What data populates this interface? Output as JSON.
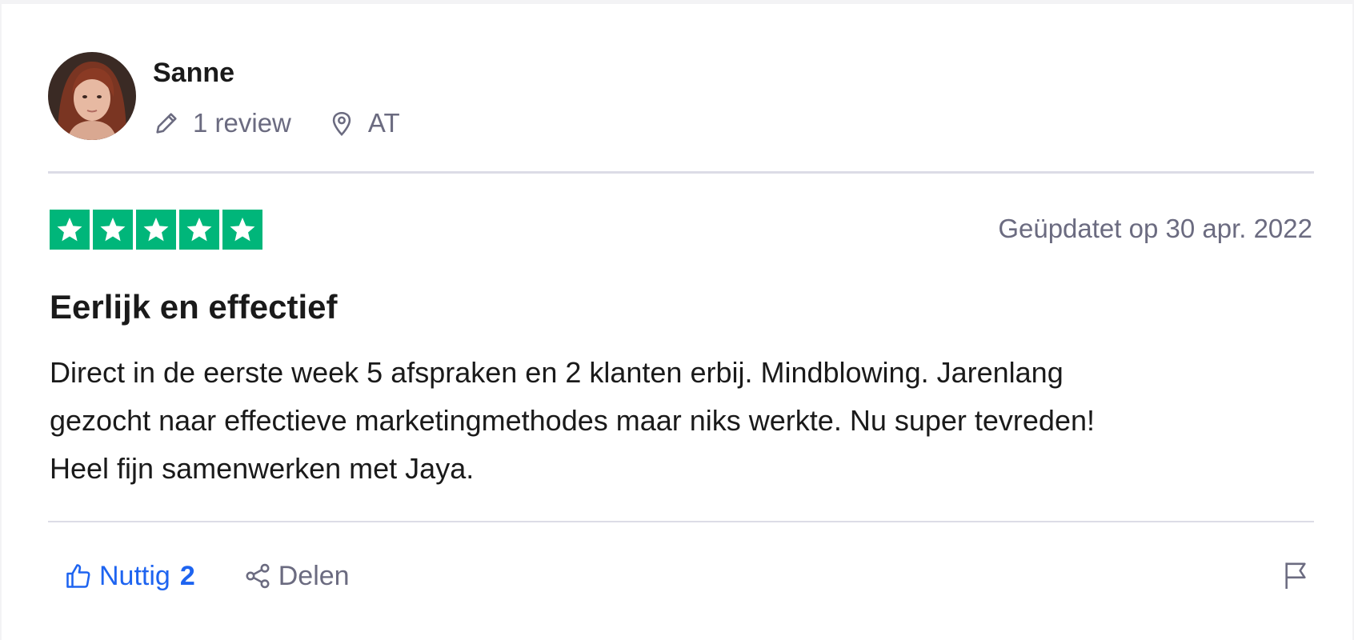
{
  "reviewer": {
    "name": "Sanne",
    "review_count_label": "1 review",
    "country": "AT"
  },
  "review": {
    "rating": 5,
    "rating_max": 5,
    "rating_color": "#00b67a",
    "date_label": "Geüpdatet op 30 apr. 2022",
    "title": "Eerlijk en effectief",
    "body_lines": [
      "Direct in de eerste week 5 afspraken en 2 klanten erbij. Mindblowing. Jarenlang",
      "gezocht naar effectieve marketingmethodes maar niks werkte. Nu super tevreden!",
      "Heel fijn samenwerken met Jaya."
    ]
  },
  "actions": {
    "helpful_label": "Nuttig",
    "helpful_count": "2",
    "share_label": "Delen",
    "helpful_icon": "thumbs-up-icon",
    "share_icon": "share-icon",
    "report_icon": "flag-icon"
  },
  "colors": {
    "accent_blue": "#1e64f0",
    "muted_text": "#6b6b80",
    "divider": "#dcdce6"
  }
}
